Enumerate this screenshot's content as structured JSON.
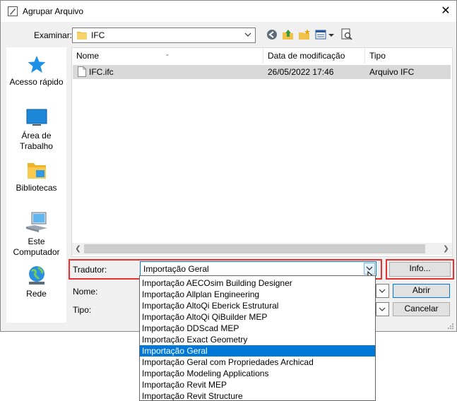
{
  "window": {
    "title": "Agrupar Arquivo",
    "close_glyph": "✕"
  },
  "lookin": {
    "label": "Examinar:",
    "value": "IFC"
  },
  "places": [
    {
      "label1": "Acesso rápido",
      "label2": "",
      "icon": "quick-access-star-icon"
    },
    {
      "label1": "Área de",
      "label2": "Trabalho",
      "icon": "desktop-icon"
    },
    {
      "label1": "Bibliotecas",
      "label2": "",
      "icon": "libraries-icon"
    },
    {
      "label1": "Este",
      "label2": "Computador",
      "icon": "computer-icon"
    },
    {
      "label1": "Rede",
      "label2": "",
      "icon": "network-globe-icon"
    }
  ],
  "filelist": {
    "columns": [
      "Nome",
      "Data de modificação",
      "Tipo"
    ],
    "rows": [
      {
        "name": "IFC.ifc",
        "date": "26/05/2022 17:46",
        "type": "Arquivo IFC"
      }
    ]
  },
  "tradutor": {
    "label": "Tradutor:",
    "value": "Importação Geral"
  },
  "buttons": {
    "info": "Info...",
    "open": "Abrir",
    "cancel": "Cancelar"
  },
  "name_label": "Nome:",
  "type_label": "Tipo:",
  "dropdown": {
    "options": [
      "Importação AECOsim Building Designer",
      "Importação Allplan Engineering",
      "Importação AltoQi Eberick Estrutural",
      "Importação AltoQi QiBuilder MEP",
      "Importação DDScad MEP",
      "Importação Exact Geometry",
      "Importação Geral",
      "Importação Geral com Propriedades Archicad",
      "Importação Modeling Applications",
      "Importação Revit MEP",
      "Importação Revit Structure"
    ],
    "selected": "Importação Geral",
    "highlight_color": "#0078d7"
  },
  "colors": {
    "highlight_annotation": "#e53333",
    "accent": "#0078d7"
  }
}
